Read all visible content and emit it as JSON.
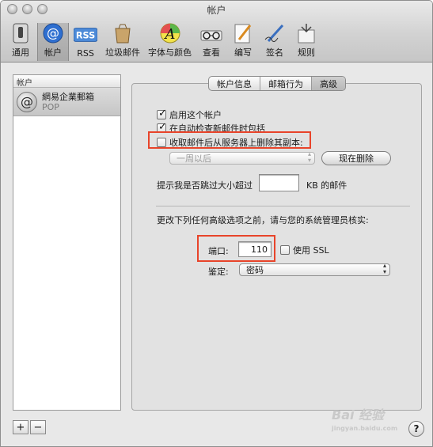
{
  "window": {
    "title": "帐户"
  },
  "toolbar": {
    "items": [
      {
        "label": "通用",
        "icon": "switch-icon"
      },
      {
        "label": "帐户",
        "icon": "at-sign-icon"
      },
      {
        "label": "RSS",
        "icon": "rss-icon"
      },
      {
        "label": "垃圾邮件",
        "icon": "junk-bag-icon"
      },
      {
        "label": "字体与颜色",
        "icon": "font-color-icon"
      },
      {
        "label": "查看",
        "icon": "glasses-icon"
      },
      {
        "label": "编写",
        "icon": "pencil-paper-icon"
      },
      {
        "label": "签名",
        "icon": "pen-signature-icon"
      },
      {
        "label": "规则",
        "icon": "rules-icon"
      }
    ],
    "selected": "帐户"
  },
  "sidebar": {
    "header": "帐户",
    "accounts": [
      {
        "name": "網易企業郵箱",
        "type": "POP"
      }
    ],
    "add_label": "+",
    "remove_label": "−"
  },
  "tabs": [
    {
      "label": "帐户信息"
    },
    {
      "label": "邮箱行为"
    },
    {
      "label": "高级"
    }
  ],
  "advanced": {
    "enable_account": {
      "label": "启用这个帐户",
      "checked": true
    },
    "auto_check": {
      "label": "在自动检查新邮件时包括",
      "checked": true
    },
    "remove_copy": {
      "label": "收取邮件后从服务器上删除其副本:",
      "checked": false
    },
    "remove_period": "一周以后",
    "remove_now_button": "现在删除",
    "size_prompt": "提示我是否跳过大小超过",
    "size_value": "",
    "size_unit": "KB 的邮件",
    "admin_note": "更改下列任何高级选项之前，请与您的系统管理员核实:",
    "port_label": "端口:",
    "port_value": "110",
    "use_ssl": {
      "label": "使用 SSL",
      "checked": false
    },
    "auth_label": "鉴定:",
    "auth_value": "密码"
  },
  "help_label": "?",
  "watermark": {
    "text": "Bai 经验",
    "sub": "jingyan.baidu.com"
  },
  "colors": {
    "highlight_box": "#e8442a"
  }
}
